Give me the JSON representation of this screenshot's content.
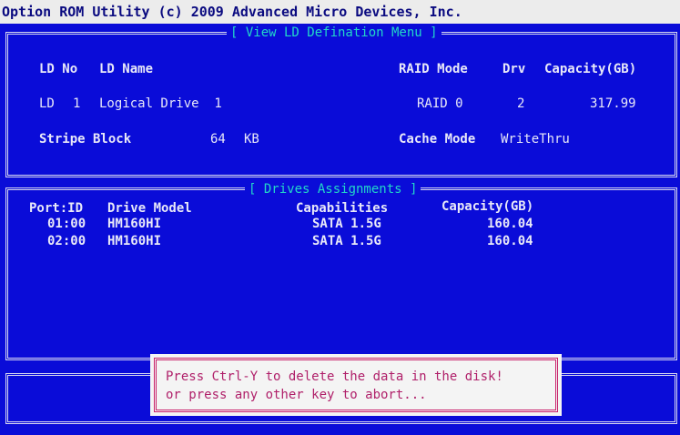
{
  "window": {
    "title": "Option ROM Utility (c) 2009 Advanced Micro Devices, Inc."
  },
  "ld_panel": {
    "title": "[ View LD Defination Menu ]",
    "headers": {
      "ld_no": "LD No",
      "ld_name": "LD Name",
      "raid_mode": "RAID Mode",
      "drv": "Drv",
      "capacity": "Capacity(GB)"
    },
    "row": {
      "ld_label": "LD",
      "ld_no": "1",
      "ld_name": "Logical Drive  1",
      "raid_mode": "RAID 0",
      "drv": "2",
      "capacity": "317.99"
    },
    "stripe": {
      "label": "Stripe Block",
      "value": "64",
      "unit": "KB"
    },
    "cache": {
      "label": "Cache Mode",
      "value": "WriteThru"
    }
  },
  "drives_panel": {
    "title": "[ Drives Assignments ]",
    "headers": {
      "port_id": "Port:ID",
      "model": "Drive Model",
      "capabilities": "Capabilities",
      "capacity": "Capacity(GB)"
    },
    "rows": [
      {
        "port_id": "01:00",
        "model": "HM160HI",
        "capabilities": "SATA 1.5G",
        "capacity": "160.04"
      },
      {
        "port_id": "02:00",
        "model": "HM160HI",
        "capabilities": "SATA 1.5G",
        "capacity": "160.04"
      }
    ]
  },
  "dialog": {
    "line1": "Press Ctrl-Y to delete the data in the disk!",
    "line2": "or press any other key to abort..."
  }
}
